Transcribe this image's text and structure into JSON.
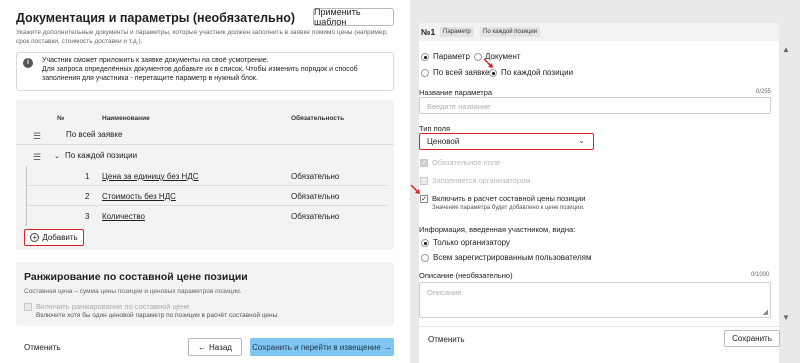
{
  "left": {
    "title": "Документация и параметры (необязательно)",
    "apply_template_label": "Применить шаблон",
    "description": "Укажите дополнительные документы и параметры, которые участник должен заполнить в заявке помимо цены (например, срок поставки, стоимость доставки и т.д.).",
    "info": {
      "icon": "info-icon",
      "line1": "Участник сможет приложить к заявке документы на своё усмотрение.",
      "line2": "Для запроса определённых документов добавьте их в список. Чтобы изменить порядок и способ заполнения для участника - перетащите параметр в нужный блок."
    },
    "table": {
      "col_num": "№",
      "col_name": "Наименование",
      "col_required": "Обязательность",
      "group_all": "По всей заявке",
      "group_each": "По каждой позиции",
      "rows": [
        {
          "num": "1",
          "name": "Цена за единицу без НДС",
          "required": "Обязательно"
        },
        {
          "num": "2",
          "name": "Стоимость без НДС",
          "required": "Обязательно"
        },
        {
          "num": "3",
          "name": "Количество",
          "required": "Обязательно"
        }
      ]
    },
    "add_label": "Добавить",
    "ranking": {
      "title": "Ранжирование по составной цене позиции",
      "description": "Составная цена – сумма цены позиции и ценовых параметров позиции.",
      "checkbox_label": "Включить ранжирование по составной цене",
      "hint": "Включите хотя бы один ценовой параметр по позиции в расчёт составной цены."
    },
    "cancel_label": "Отменить",
    "back_label": "Назад",
    "next_label": "Сохранить и перейти в извещение"
  },
  "right": {
    "header_num": "№1",
    "pill_param": "Параметр",
    "pill_each": "По каждой позиции",
    "kind_param": "Параметр",
    "kind_doc": "Документ",
    "scope_all": "По всей заявке",
    "scope_each": "По каждой позиции",
    "name_label": "Название параметра",
    "name_counter": "0/255",
    "name_placeholder": "Введите название",
    "type_label": "Тип поля",
    "type_value": "Ценовой",
    "required_label": "Обязательное поле",
    "org_label": "Заполняется организатором",
    "include_label": "Включить в расчет составной цены позиции",
    "include_hint": "Значение параметра будет добавлено к цене позиции.",
    "visibility_label": "Информация, введенная участником, видна:",
    "vis_org": "Только организатору",
    "vis_all": "Всем зарегистрированным пользователям",
    "desc_label": "Описание (необязательно)",
    "desc_counter": "0/1000",
    "desc_placeholder": "Описание",
    "cancel_label": "Отменить",
    "save_label": "Сохранить"
  },
  "colors": {
    "highlight": "#dd2222",
    "primary_button": "#7fc6f2",
    "panel_bg": "#e9e9e9"
  }
}
